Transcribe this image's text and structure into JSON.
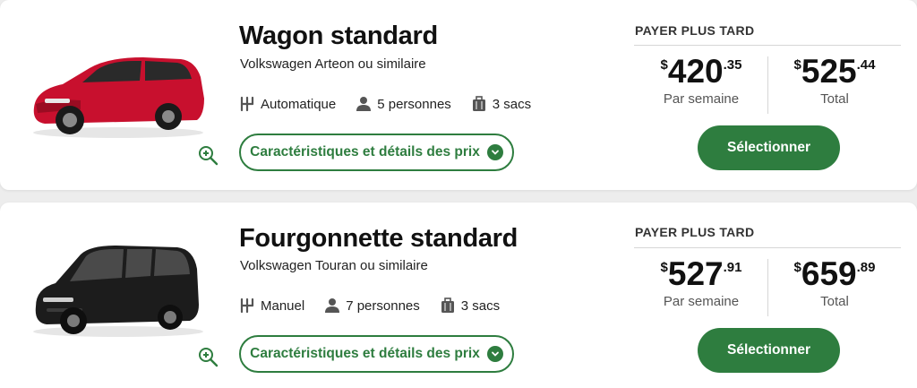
{
  "vehicles": [
    {
      "title": "Wagon standard",
      "model": "Volkswagen Arteon ou similaire",
      "transmission": "Automatique",
      "passengers": "5 personnes",
      "bags": "3 sacs",
      "details_label": "Caractéristiques et détails des prix",
      "pay_label": "PAYER PLUS TARD",
      "weekly": {
        "currency": "$",
        "int": "420",
        "dec": ".35",
        "label": "Par semaine"
      },
      "total": {
        "currency": "$",
        "int": "525",
        "dec": ".44",
        "label": "Total"
      },
      "select_label": "Sélectionner",
      "car_color": "#c8102e"
    },
    {
      "title": "Fourgonnette standard",
      "model": "Volkswagen Touran ou similaire",
      "transmission": "Manuel",
      "passengers": "7 personnes",
      "bags": "3 sacs",
      "details_label": "Caractéristiques et détails des prix",
      "pay_label": "PAYER PLUS TARD",
      "weekly": {
        "currency": "$",
        "int": "527",
        "dec": ".91",
        "label": "Par semaine"
      },
      "total": {
        "currency": "$",
        "int": "659",
        "dec": ".89",
        "label": "Total"
      },
      "select_label": "Sélectionner",
      "car_color": "#1c1c1c"
    }
  ],
  "theme": {
    "accent": "#2e7d3f"
  }
}
